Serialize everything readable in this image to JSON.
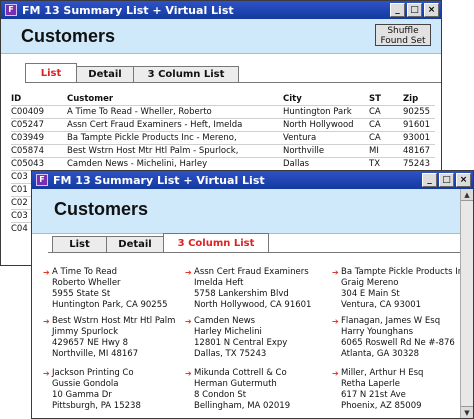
{
  "back_window": {
    "title": "FM 13 Summary List + Virtual List",
    "page_title": "Customers",
    "shuffle_label": "Shuffle Found Set",
    "tabs": [
      "List",
      "Detail",
      "3 Column List"
    ],
    "active_tab": "List",
    "columns": [
      "ID",
      "Customer",
      "City",
      "ST",
      "Zip"
    ],
    "rows": [
      [
        "C00409",
        "A Time To Read - Wheller, Roberto",
        "Huntington Park",
        "CA",
        "90255"
      ],
      [
        "C05247",
        "Assn Cert Fraud Examiners - Heft, Imelda",
        "North Hollywood",
        "CA",
        "91601"
      ],
      [
        "C03949",
        "Ba Tampte Pickle Products Inc - Mereno,",
        "Ventura",
        "CA",
        "93001"
      ],
      [
        "C05874",
        "Best Wstrn Host Mtr Htl Palm - Spurlock,",
        "Northville",
        "MI",
        "48167"
      ],
      [
        "C05043",
        "Camden News - Michelini, Harley",
        "Dallas",
        "TX",
        "75243"
      ],
      [
        "C03",
        "",
        "",
        "",
        ""
      ],
      [
        "C01",
        "",
        "",
        "",
        ""
      ],
      [
        "C02",
        "",
        "",
        "",
        ""
      ],
      [
        "C03",
        "",
        "",
        "",
        ""
      ],
      [
        "C04",
        "",
        "",
        "",
        ""
      ]
    ]
  },
  "front_window": {
    "title": "FM 13 Summary List + Virtual List",
    "page_title": "Customers",
    "tabs": [
      "List",
      "Detail",
      "3 Column List"
    ],
    "active_tab": "3 Column List",
    "cards": [
      {
        "name": "A Time To Read",
        "contact": "Roberto Wheller",
        "street": "5955 State St",
        "cityline": "Huntington Park, CA 90255"
      },
      {
        "name": "Assn Cert Fraud Examiners",
        "contact": "Imelda Heft",
        "street": "5758 Lankershim Blvd",
        "cityline": "North Hollywood, CA 91601"
      },
      {
        "name": "Ba Tampte Pickle Products Inc",
        "contact": "Graig Mereno",
        "street": "304 E Main St",
        "cityline": "Ventura, CA 93001"
      },
      {
        "name": "Best Wstrn Host Mtr Htl Palm",
        "contact": "Jimmy Spurlock",
        "street": "429657 NE Hwy 8",
        "cityline": "Northville, MI 48167"
      },
      {
        "name": "Camden News",
        "contact": "Harley Michelini",
        "street": "12801 N Central Expy",
        "cityline": "Dallas, TX 75243"
      },
      {
        "name": "Flanagan, James W Esq",
        "contact": "Harry Younghans",
        "street": "6065 Roswell Rd Ne #-876",
        "cityline": "Atlanta, GA 30328"
      },
      {
        "name": "Jackson Printing Co",
        "contact": "Gussie Gondola",
        "street": "10 Gamma Dr",
        "cityline": "Pittsburgh, PA 15238"
      },
      {
        "name": "Mikunda Cottrell & Co",
        "contact": "Herman Gutermuth",
        "street": "8 Condon St",
        "cityline": "Bellingham, MA 02019"
      },
      {
        "name": "Miller, Arthur H Esq",
        "contact": "Retha Laperle",
        "street": "617 N 21st Ave",
        "cityline": "Phoenix, AZ 85009"
      }
    ]
  }
}
